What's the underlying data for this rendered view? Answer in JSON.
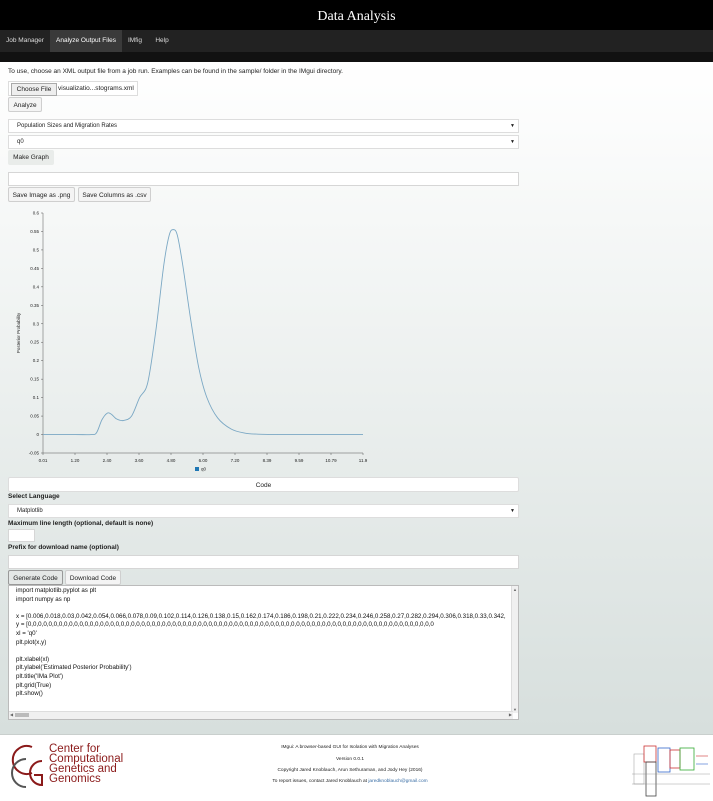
{
  "header": {
    "title": "Data Analysis"
  },
  "nav": {
    "items": [
      "Job Manager",
      "Analyze Output Files",
      "IMfig",
      "Help"
    ],
    "active": 1
  },
  "intro": "To use, choose an XML output file from a job run. Examples can be found in the sample/ folder in the IMgui directory.",
  "file": {
    "choose_label": "Choose File",
    "filename": "visualizatio...stograms.xml"
  },
  "analyze_label": "Analyze",
  "select_type": {
    "value": "Population Sizes and Migration Rates"
  },
  "select_param": {
    "value": "q0"
  },
  "make_graph_label": "Make Graph",
  "save_png_label": "Save Image as .png",
  "save_csv_label": "Save Columns as .csv",
  "chart_data": {
    "type": "line",
    "xlabel": "",
    "ylabel": "Posterior Probability",
    "ylim": [
      -0.05,
      0.6
    ],
    "xlim": [
      0.01,
      11.9
    ],
    "x_ticks": [
      "0.01",
      "1.20",
      "2.40",
      "3.60",
      "4.80",
      "6.00",
      "7.20",
      "8.39",
      "9.59",
      "10.79",
      "11.9"
    ],
    "y_ticks": [
      "-0.05",
      "0",
      "0.05",
      "0.1",
      "0.15",
      "0.2",
      "0.25",
      "0.3",
      "0.35",
      "0.4",
      "0.45",
      "0.5",
      "0.55",
      "0.6"
    ],
    "grid": false,
    "legend": {
      "position": "bottom-center",
      "entries": [
        "q0"
      ]
    },
    "series": [
      {
        "name": "q0",
        "color": "#7ba8c4",
        "x": [
          0.01,
          1.2,
          1.8,
          2.0,
          2.2,
          2.4,
          2.55,
          2.75,
          3.0,
          3.3,
          3.6,
          3.9,
          4.2,
          4.5,
          4.7,
          4.85,
          5.0,
          5.2,
          5.5,
          5.8,
          6.1,
          6.5,
          7.0,
          7.5,
          8.0,
          9.0,
          10.0,
          11.9
        ],
        "y": [
          0,
          0,
          0,
          0.005,
          0.04,
          0.058,
          0.055,
          0.042,
          0.038,
          0.05,
          0.1,
          0.14,
          0.28,
          0.46,
          0.54,
          0.555,
          0.54,
          0.46,
          0.31,
          0.18,
          0.1,
          0.045,
          0.015,
          0.004,
          0.001,
          0,
          0,
          0
        ]
      }
    ]
  },
  "code_label": "Code",
  "select_language": {
    "label": "Select Language",
    "value": "Matplotlib"
  },
  "max_line": {
    "label": "Maximum line length (optional, default is none)"
  },
  "prefix": {
    "label": "Prefix for download name (optional)"
  },
  "generate_label": "Generate Code",
  "download_label": "Download Code",
  "code_lines": [
    "import matplotlib.pyplot as plt",
    "import numpy as np",
    "",
    "x = [0.006,0.018,0.03,0.042,0.054,0.066,0.078,0.09,0.102,0.114,0.126,0.138,0.15,0.162,0.174,0.186,0.198,0.21,0.222,0.234,0.246,0.258,0.27,0.282,0.294,0.306,0.318,0.33,0.342,",
    "y = [0,0,0,0,0,0,0,0,0,0,0,0,0,0,0,0,0,0,0,0,0,0,0,0,0,0,0,0,0,0,0,0,0,0,0,0,0,0,0,0,0,0,0,0,0,0,0,0,0,0,0,0,0,0,0,0,0,0,0,0,0,0,0,0,0,0,0,0,0,0,0,0,0,0,0,0,0,0,0",
    "xl = 'q0'",
    "plt.plot(x,y)",
    "",
    "plt.xlabel(xl)",
    "plt.ylabel('Estimated Posterior Probability')",
    "plt.title('IMa Plot')",
    "plt.grid(True)",
    "plt.show()"
  ],
  "footer": {
    "logo": [
      "Center for",
      "Computational",
      "Genetics and",
      "Genomics"
    ],
    "logo_mark": "CGG",
    "line1": "IMgui: A browser-based GUI for Isolation with Migration Analyses",
    "line2": "Version 0.0.1",
    "line3": "Copyright Jared Knoblauch, Arun Sethuraman, and Jody Hey (2016)",
    "line4_prefix": "To report issues, contact Jared Knoblauch at ",
    "email": "jaredknoblauch@gmail.com"
  }
}
